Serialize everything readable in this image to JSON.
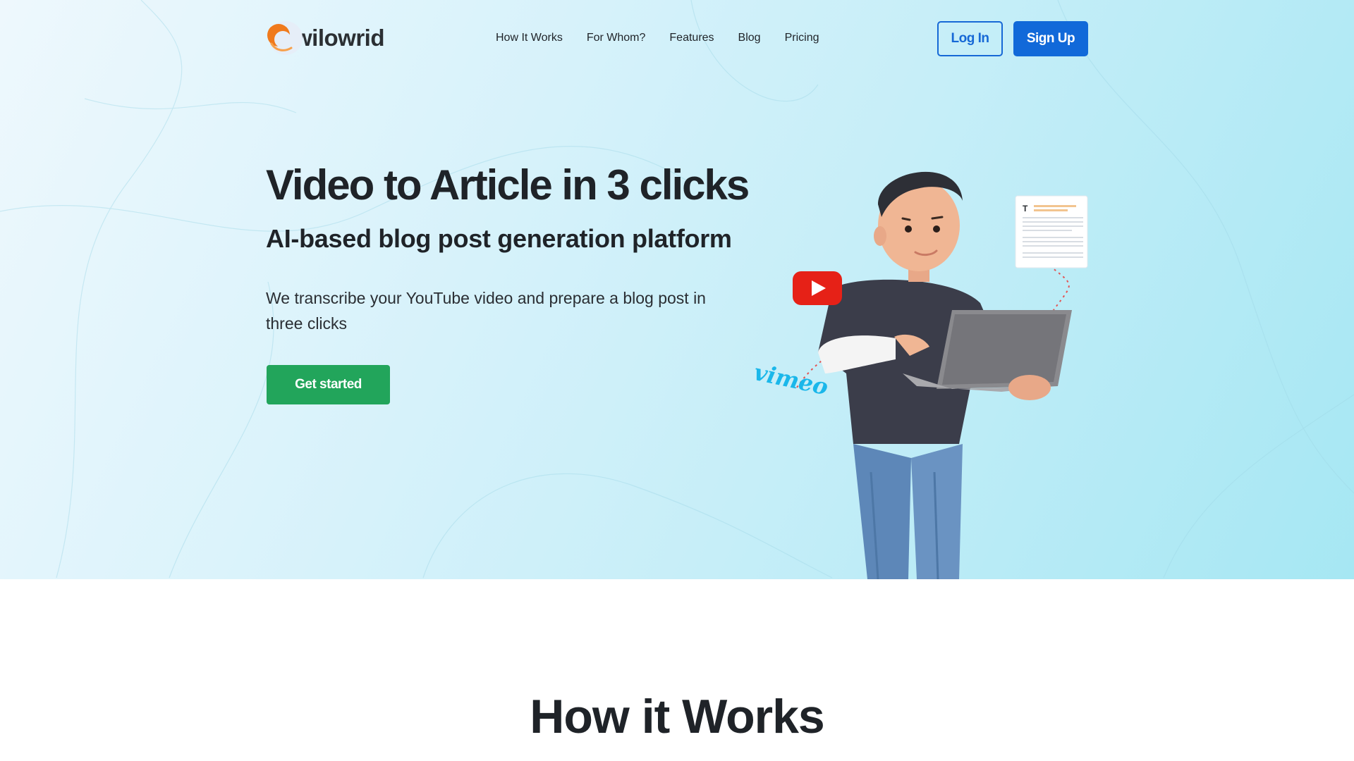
{
  "brand": {
    "name": "wilowrid"
  },
  "nav": {
    "items": [
      {
        "label": "How It Works"
      },
      {
        "label": "For Whom?"
      },
      {
        "label": "Features"
      },
      {
        "label": "Blog"
      },
      {
        "label": "Pricing"
      }
    ]
  },
  "auth": {
    "login_label": "Log In",
    "signup_label": "Sign Up"
  },
  "hero": {
    "title": "Video to Article in 3 clicks",
    "subtitle": "AI-based blog post generation platform",
    "description": "We transcribe your YouTube video and prepare a blog post in three clicks",
    "cta_label": "Get started",
    "illustration": {
      "vimeo_text": "vimeo",
      "document_letter": "T"
    }
  },
  "how_it_works": {
    "title": "How it Works"
  },
  "colors": {
    "primary_blue": "#1169d9",
    "cta_green": "#22a55b",
    "youtube_red": "#e62117",
    "vimeo_blue": "#1ab7ea",
    "logo_orange": "#f07a1c"
  }
}
